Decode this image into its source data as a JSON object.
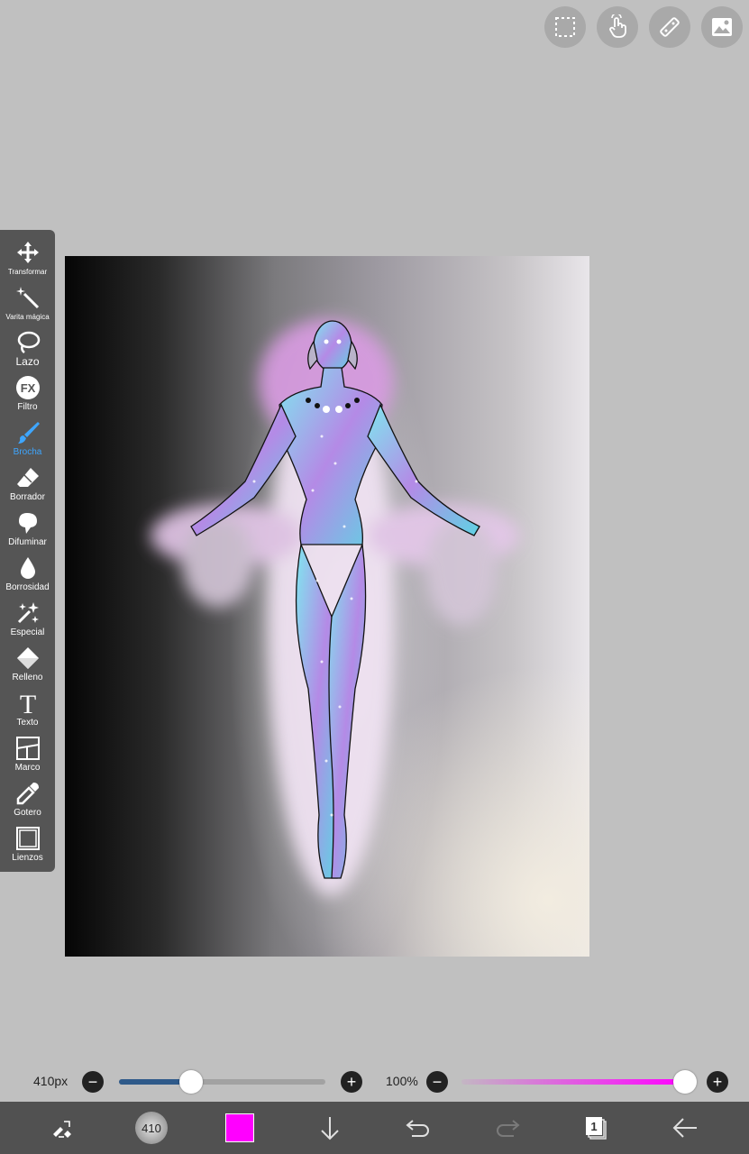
{
  "topbar": {
    "buttons": [
      {
        "name": "selection-icon"
      },
      {
        "name": "touch-gesture-icon"
      },
      {
        "name": "ruler-icon"
      },
      {
        "name": "image-material-icon"
      }
    ]
  },
  "toolbar": {
    "tools": [
      {
        "key": "transform",
        "label": "Transformar",
        "icon": "move-arrows-icon"
      },
      {
        "key": "magic-wand",
        "label": "Varita mágica",
        "icon": "magic-wand-icon"
      },
      {
        "key": "lasso",
        "label": "Lazo",
        "icon": "lasso-icon"
      },
      {
        "key": "filter",
        "label": "Filtro",
        "icon": "fx-filter-icon",
        "icon_text": "FX"
      },
      {
        "key": "brush",
        "label": "Brocha",
        "icon": "brush-icon",
        "active": true
      },
      {
        "key": "eraser",
        "label": "Borrador",
        "icon": "eraser-icon"
      },
      {
        "key": "smudge",
        "label": "Difuminar",
        "icon": "smudge-icon"
      },
      {
        "key": "blur",
        "label": "Borrosidad",
        "icon": "blur-drop-icon"
      },
      {
        "key": "special",
        "label": "Especial",
        "icon": "sparkle-icon"
      },
      {
        "key": "fill",
        "label": "Relleno",
        "icon": "fill-bucket-icon"
      },
      {
        "key": "text",
        "label": "Texto",
        "icon": "text-icon",
        "icon_text": "T"
      },
      {
        "key": "frame",
        "label": "Marco",
        "icon": "frame-divider-icon"
      },
      {
        "key": "eyedropper",
        "label": "Gotero",
        "icon": "eyedropper-icon"
      },
      {
        "key": "canvas",
        "label": "Lienzos",
        "icon": "canvas-icon"
      }
    ],
    "active_color": "#3ea6ff"
  },
  "brush_controls": {
    "size_label": "410px",
    "size_fraction": 0.35,
    "opacity_label": "100%",
    "opacity_fraction": 1.0,
    "minus": "−",
    "plus": "+"
  },
  "bottombar": {
    "brush_size_preview": "410",
    "current_color": "#ff00ff",
    "layer_count": "1",
    "buttons": [
      {
        "name": "swap-eraser-icon"
      },
      {
        "name": "brush-size-preview"
      },
      {
        "name": "color-swatch"
      },
      {
        "name": "download-arrow-icon"
      },
      {
        "name": "undo-icon"
      },
      {
        "name": "redo-icon"
      },
      {
        "name": "layers-icon"
      },
      {
        "name": "back-arrow-icon"
      }
    ]
  },
  "colors": {
    "background": "#c0c0c0",
    "toolbar": "#555555",
    "bottombar": "#515151",
    "size_track": "#2f5a8a",
    "opacity_track": "#ff00ff"
  }
}
